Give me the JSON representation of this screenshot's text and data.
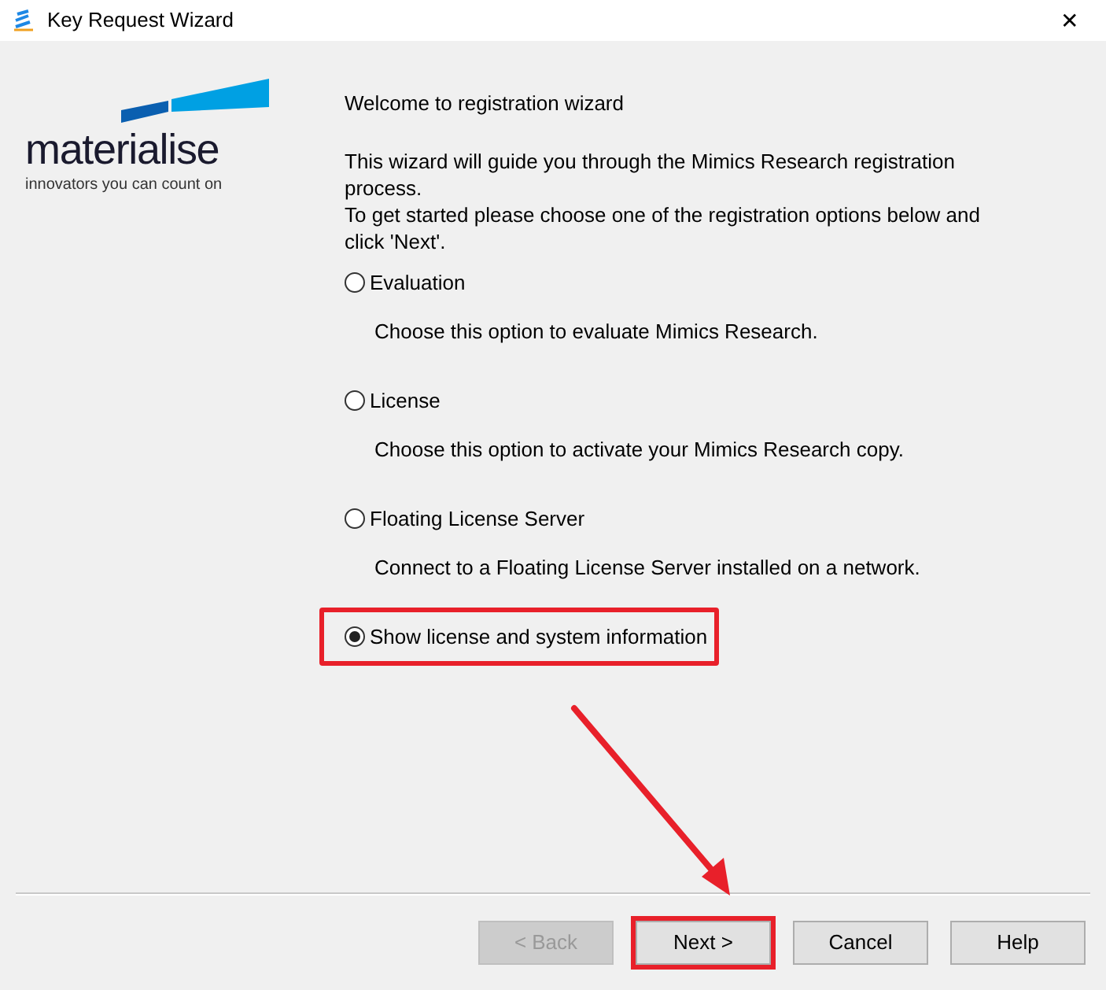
{
  "window": {
    "title": "Key Request Wizard",
    "close": "✕"
  },
  "logo": {
    "name": "materialise",
    "tagline": "innovators you can count on"
  },
  "heading": "Welcome to registration wizard",
  "intro": [
    "This wizard will guide you through the Mimics Research registration process.",
    "To get started please choose one of the registration options below and click 'Next'."
  ],
  "options": [
    {
      "label": "Evaluation",
      "description": "Choose this option to evaluate Mimics Research.",
      "selected": false,
      "highlighted": false
    },
    {
      "label": "License",
      "description": "Choose this option to activate your Mimics Research copy.",
      "selected": false,
      "highlighted": false
    },
    {
      "label": "Floating License Server",
      "description": "Connect to a Floating License Server installed on a network.",
      "selected": false,
      "highlighted": false
    },
    {
      "label": "Show license and system information",
      "selected": true,
      "highlighted": true
    }
  ],
  "buttons": [
    {
      "label": "< Back",
      "disabled": true,
      "highlighted": false
    },
    {
      "label": "Next >",
      "disabled": false,
      "highlighted": true
    },
    {
      "label": "Cancel",
      "disabled": false,
      "highlighted": false
    },
    {
      "label": "Help",
      "disabled": false,
      "highlighted": false
    }
  ]
}
